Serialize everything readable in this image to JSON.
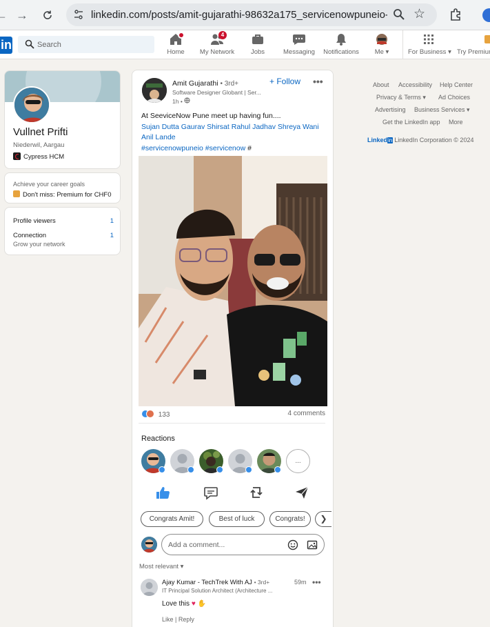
{
  "browser": {
    "url": "linkedin.com/posts/amit-gujarathi-98632a175_servicenowpuneio-s..."
  },
  "header": {
    "logo": "in",
    "search_placeholder": "Search",
    "nav": {
      "home": "Home",
      "network": "My Network",
      "network_badge": "4",
      "jobs": "Jobs",
      "messaging": "Messaging",
      "notifications": "Notifications",
      "me": "Me",
      "business": "For Business",
      "premium": "Try Premium"
    }
  },
  "profile": {
    "name": "Vullnet Prifti",
    "location": "Niederwil, Aargau",
    "company": "Cypress HCM",
    "premium_prompt": "Achieve your career goals",
    "premium_cta": "Don't miss: Premium for CHF0",
    "profile_viewers_label": "Profile viewers",
    "profile_viewers": "1",
    "connection_label": "Connection",
    "connection_count": "1",
    "connection_sub": "Grow your network"
  },
  "post": {
    "author": "Amit Gujarathi",
    "degree": "• 3rd+",
    "author_title": "Software Designer Globant | Ser...",
    "time": "1h •",
    "follow_label": "+ Follow",
    "more": "•••",
    "text": "At SeeviceNow Pune meet up having fun....",
    "mentions": "Sujan Dutta Gaurav Shirsat Rahul Jadhav Shreya Wani Anil Lande",
    "hashtags": "#servicenowpuneio #servicenow",
    "hash_tail": "#",
    "reaction_count": "133",
    "comments_count": "4 comments",
    "reactions_title": "Reactions",
    "more_reactors": "...",
    "chips": [
      "Congrats Amit!",
      "Best of luck",
      "Congrats!"
    ],
    "chip_next": "❯",
    "comment_placeholder": "Add a comment...",
    "sort_label": "Most relevant ▾"
  },
  "comment": {
    "name": "Ajay Kumar - TechTrek With AJ",
    "degree": "• 3rd+",
    "title": "IT Principal Solution Architect (Architecture ...",
    "time": "59m",
    "more": "•••",
    "text": "Love this",
    "like": "Like",
    "sep": "|",
    "reply": "Reply"
  },
  "footer": {
    "about": "About",
    "accessibility": "Accessibility",
    "help": "Help Center",
    "privacy": "Privacy & Terms ▾",
    "ad_choices": "Ad Choices",
    "advertising": "Advertising",
    "business_services": "Business Services ▾",
    "get_app": "Get the LinkedIn app",
    "more": "More",
    "brand_linked": "Linked",
    "brand_in": "in",
    "corp": "LinkedIn Corporation © 2024"
  },
  "colors": {
    "brand_blue": "#0a66c2",
    "notification_red": "#cb112d",
    "page_bg": "#f4f2ee"
  }
}
